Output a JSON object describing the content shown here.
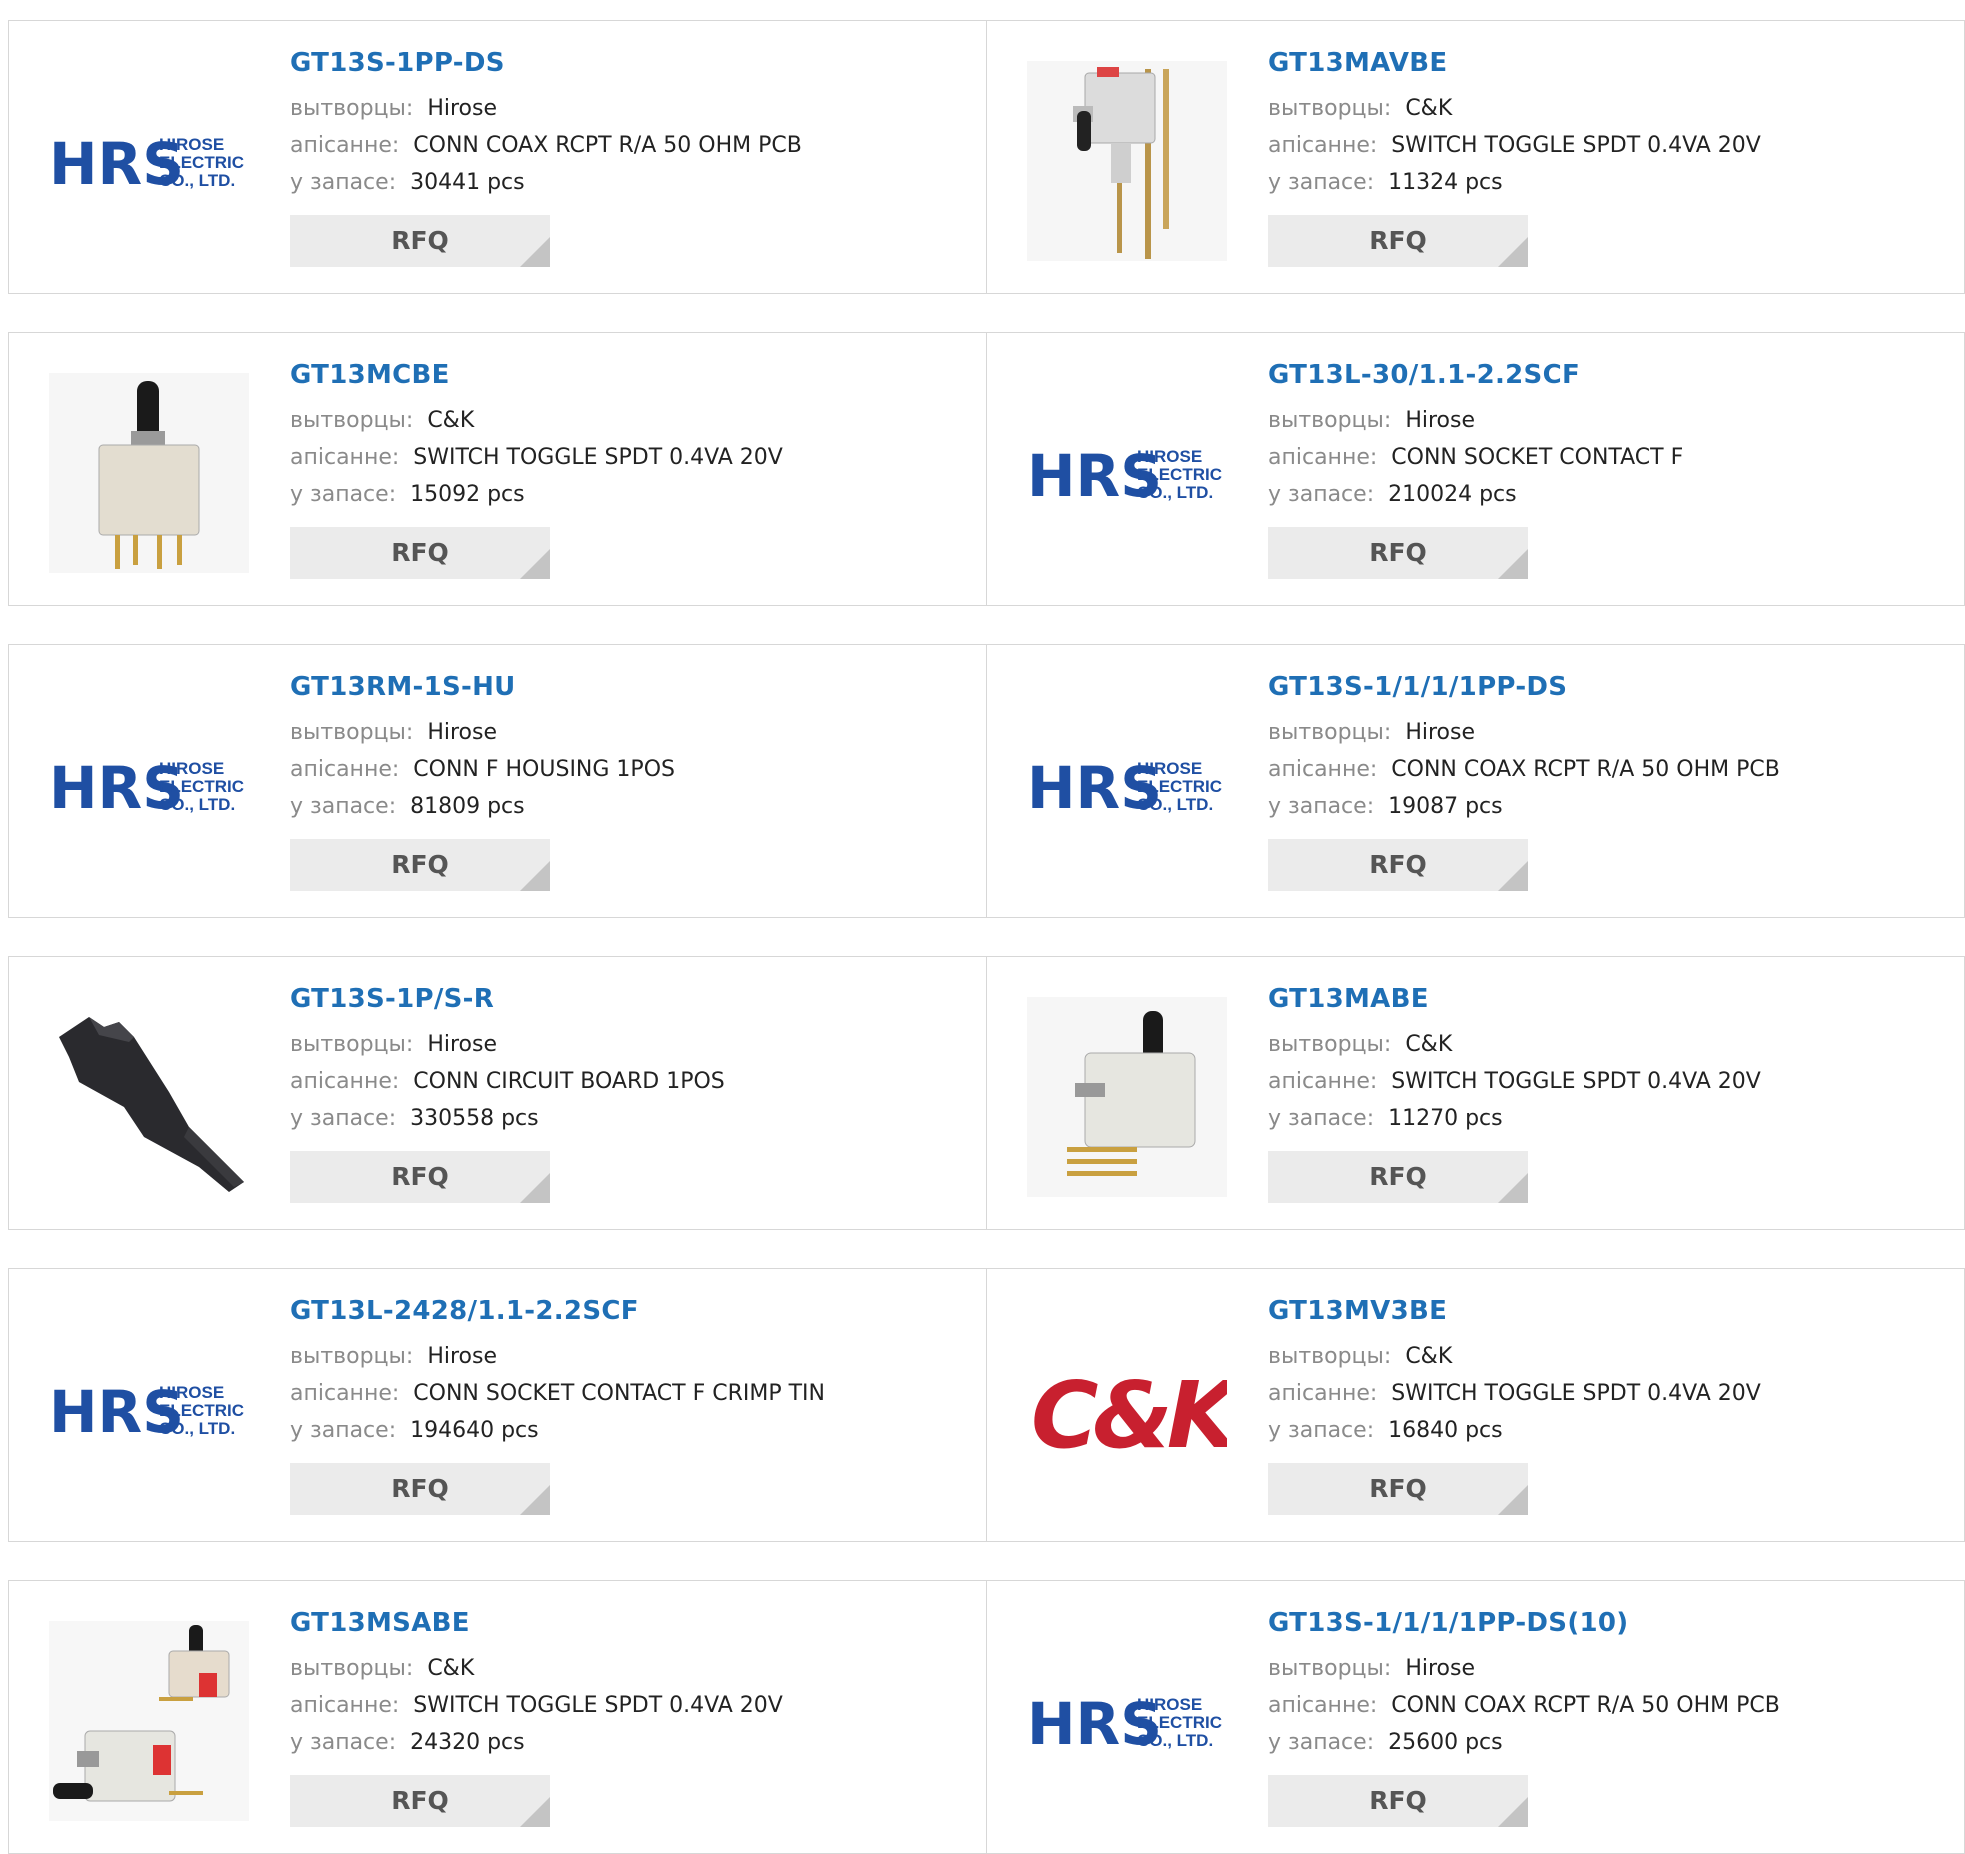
{
  "labels": {
    "maker": "вытворцы:",
    "description": "апісанне:",
    "stock": "у запасе:"
  },
  "products": [
    {
      "part": "GT13S-1PP-DS",
      "maker": "Hirose",
      "description": "CONN COAX RCPT R/A 50 OHM PCB",
      "stock": "30441 pcs",
      "image": "hrs-logo",
      "rfq": "RFQ"
    },
    {
      "part": "GT13MAVBE",
      "maker": "C&K",
      "description": "SWITCH TOGGLE SPDT 0.4VA 20V",
      "stock": "11324 pcs",
      "image": "toggle-switch-right-angle-photo",
      "rfq": "RFQ"
    },
    {
      "part": "GT13MCBE",
      "maker": "C&K",
      "description": "SWITCH TOGGLE SPDT 0.4VA 20V",
      "stock": "15092 pcs",
      "image": "toggle-switch-vertical-photo",
      "rfq": "RFQ"
    },
    {
      "part": "GT13L-30/1.1-2.2SCF",
      "maker": "Hirose",
      "description": "CONN SOCKET CONTACT F",
      "stock": "210024 pcs",
      "image": "hrs-logo",
      "rfq": "RFQ"
    },
    {
      "part": "GT13RM-1S-HU",
      "maker": "Hirose",
      "description": "CONN F HOUSING 1POS",
      "stock": "81809 pcs",
      "image": "hrs-logo",
      "rfq": "RFQ"
    },
    {
      "part": "GT13S-1/1/1/1PP-DS",
      "maker": "Hirose",
      "description": "CONN COAX RCPT R/A 50 OHM PCB",
      "stock": "19087 pcs",
      "image": "hrs-logo",
      "rfq": "RFQ"
    },
    {
      "part": "GT13S-1P/S-R",
      "maker": "Hirose",
      "description": "CONN CIRCUIT BOARD 1POS",
      "stock": "330558 pcs",
      "image": "black-plastic-connector-photo",
      "rfq": "RFQ"
    },
    {
      "part": "GT13MABE",
      "maker": "C&K",
      "description": "SWITCH TOGGLE SPDT 0.4VA 20V",
      "stock": "11270 pcs",
      "image": "toggle-switch-horizontal-photo",
      "rfq": "RFQ"
    },
    {
      "part": "GT13L-2428/1.1-2.2SCF",
      "maker": "Hirose",
      "description": "CONN SOCKET CONTACT F CRIMP TIN",
      "stock": "194640 pcs",
      "image": "hrs-logo",
      "rfq": "RFQ"
    },
    {
      "part": "GT13MV3BE",
      "maker": "C&K",
      "description": "SWITCH TOGGLE SPDT 0.4VA 20V",
      "stock": "16840 pcs",
      "image": "ck-logo",
      "rfq": "RFQ"
    },
    {
      "part": "GT13MSABE",
      "maker": "C&K",
      "description": "SWITCH TOGGLE SPDT 0.4VA 20V",
      "stock": "24320 pcs",
      "image": "two-toggle-switches-photo",
      "rfq": "RFQ"
    },
    {
      "part": "GT13S-1/1/1/1PP-DS(10)",
      "maker": "Hirose",
      "description": "CONN COAX RCPT R/A 50 OHM PCB",
      "stock": "25600 pcs",
      "image": "hrs-logo",
      "rfq": "RFQ"
    }
  ],
  "logos": {
    "hrs": {
      "mark": "HRS",
      "line1": "HIROSE",
      "line2": "ELECTRIC",
      "line3": "CO., LTD."
    },
    "ck": {
      "mark": "C&K"
    }
  },
  "colors": {
    "link": "#1f6fb5",
    "hrs_blue": "#1f4fa3",
    "ck_red": "#c8202f",
    "button_bg": "#ebebeb"
  }
}
